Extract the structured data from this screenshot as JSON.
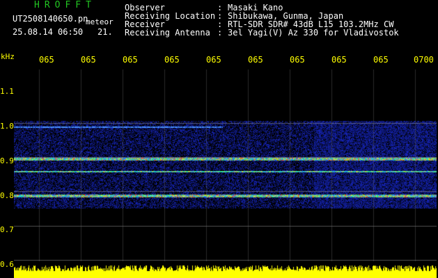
{
  "header": {
    "brand": "HROFFT",
    "filename": "UT2508140650.pn",
    "mode": "meteor",
    "timestamp": "25.08.14 06:50",
    "count": "21."
  },
  "info": [
    {
      "key": "Observer",
      "sep": ":",
      "value": "Masaki Kano"
    },
    {
      "key": "Receiving Location",
      "sep": ":",
      "value": "Shibukawa, Gunma, Japan"
    },
    {
      "key": "Receiver",
      "sep": ":",
      "value": "RTL-SDR SDR# 43dB L15 103.2MHz CW"
    },
    {
      "key": "Receiving Antenna",
      "sep": ":",
      "value": "3el Yagi(V) Az 330 for Vladivostok"
    }
  ],
  "axis": {
    "y_unit": "kHz",
    "x_labels": [
      "065",
      "065",
      "065",
      "065",
      "065",
      "065",
      "065",
      "065",
      "065",
      "0700"
    ],
    "y_labels": [
      "1.1",
      "1.0",
      "0.9",
      "0.8",
      "0.7",
      "0.6"
    ]
  },
  "colors": {
    "background": "#000000",
    "label": "#ffff00",
    "brand": "#22c422",
    "noise": "#1020a0",
    "strong_signal": "#ff3030",
    "level_bar": "#ffff00"
  }
}
